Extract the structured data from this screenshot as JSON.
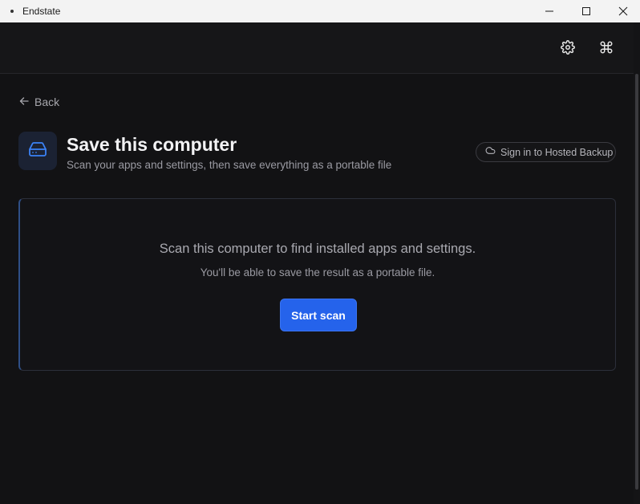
{
  "window": {
    "title": "Endstate",
    "controls": [
      "minimize-icon",
      "maximize-icon",
      "close-icon"
    ]
  },
  "toolbar": {
    "icons": [
      "gear-icon",
      "command-icon"
    ]
  },
  "nav": {
    "back_label": "Back"
  },
  "header": {
    "icon": "drive-icon",
    "title": "Save this computer",
    "subtitle": "Scan your apps and settings, then save everything as a portable file",
    "signin_icon": "cloud-icon",
    "signin_label": "Sign in to Hosted Backup"
  },
  "scan": {
    "heading": "Scan this computer to find installed apps and settings.",
    "subtext": "You'll be able to save the result as a portable file.",
    "button_label": "Start scan"
  },
  "colors": {
    "background": "#121214",
    "accent": "#2563eb",
    "titlebar": "#f3f3f3",
    "icon_tile": "#1b2233"
  }
}
